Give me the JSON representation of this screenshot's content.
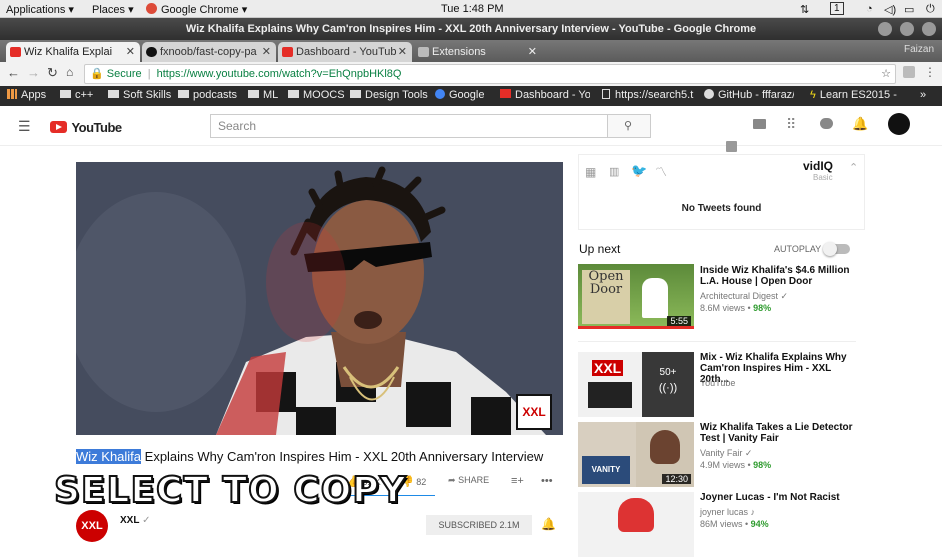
{
  "system_bar": {
    "applications": "Applications",
    "places": "Places",
    "active_app": "Google Chrome",
    "clock": "Tue 1:48 PM",
    "workspace": "1"
  },
  "window": {
    "title": "Wiz Khalifa Explains Why Cam'ron Inspires Him - XXL 20th Anniversary Interview - YouTube - Google Chrome",
    "profile": "Faizan"
  },
  "tabs": [
    {
      "label": "Wiz Khalifa Explai"
    },
    {
      "label": "fxnoob/fast-copy-pa"
    },
    {
      "label": "Dashboard - YouTub"
    },
    {
      "label": "Extensions"
    }
  ],
  "toolbar": {
    "secure_label": "Secure",
    "url": "https://www.youtube.com/watch?v=EhQnpbHKl8Q"
  },
  "bookmarks": [
    {
      "label": "Apps"
    },
    {
      "label": "c++"
    },
    {
      "label": "Soft Skills"
    },
    {
      "label": "podcasts"
    },
    {
      "label": "ML"
    },
    {
      "label": "MOOCS"
    },
    {
      "label": "Design Tools"
    },
    {
      "label": "Google"
    },
    {
      "label": "Dashboard - You"
    },
    {
      "label": "https://search5.t"
    },
    {
      "label": "GitHub - fffaraz/"
    },
    {
      "label": "Learn ES2015 -"
    }
  ],
  "youtube": {
    "logo_text": "YouTube",
    "search_placeholder": "Search"
  },
  "video": {
    "channel_watermark": "XXL",
    "title_highlight": "Wiz Khalifa",
    "title_rest": " Explains Why Cam'ron Inspires Him - XXL 20th Anniversary Interview",
    "likes": "3.2K",
    "dislikes": "82",
    "share": "SHARE",
    "channel_name": "XXL",
    "subscribe": "SUBSCRIBED 2.1M"
  },
  "vidiq": {
    "brand": "vidIQ",
    "sub": "Basic",
    "no_tweets": "No Tweets found"
  },
  "up_next": {
    "heading": "Up next",
    "autoplay": "AUTOPLAY"
  },
  "related": [
    {
      "title": "Inside Wiz Khalifa's $4.6 Million L.A. House | Open Door",
      "channel": "Architectural Digest",
      "views": "8.6M views",
      "score": "98%",
      "duration": "5:55",
      "thumb_text": "Open Door"
    },
    {
      "title": "Mix - Wiz Khalifa Explains Why Cam'ron Inspires Him - XXL 20th...",
      "channel": "YouTube",
      "views": "",
      "score": "",
      "duration": "",
      "thumb_text": "XXL",
      "badge": "50+"
    },
    {
      "title": "Wiz Khalifa Takes a Lie Detector Test | Vanity Fair",
      "channel": "Vanity Fair",
      "views": "4.9M views",
      "score": "98%",
      "duration": "12:30",
      "thumb_text": "VANITY FAIR"
    },
    {
      "title": "Joyner Lucas - I'm Not Racist",
      "channel": "joyner lucas",
      "views": "86M views",
      "score": "94%",
      "duration": "",
      "thumb_text": ""
    }
  ],
  "overlay": {
    "text": "SELECT TO COPY"
  }
}
